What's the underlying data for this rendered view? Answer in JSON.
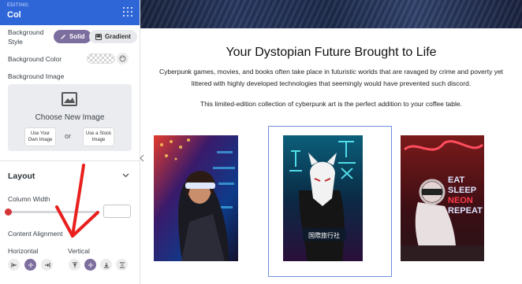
{
  "sidebar": {
    "editing_label": "EDITING:",
    "title": "Col",
    "background_style": {
      "label": "Background Style",
      "options": [
        "Solid",
        "Gradient"
      ],
      "selected": "Solid"
    },
    "background_color": {
      "label": "Background Color"
    },
    "background_image": {
      "label": "Background Image",
      "choose": "Choose New Image",
      "own_image": "Use Your Own Image",
      "or": "or",
      "stock_image": "Use a Stock Image"
    },
    "layout": {
      "heading": "Layout",
      "column_width_label": "Column Width",
      "column_width_value": "",
      "content_alignment_label": "Content Alignment",
      "horizontal_label": "Horizontal",
      "vertical_label": "Vertical",
      "horizontal_selected": "center",
      "vertical_selected": "center"
    },
    "colors": {
      "accent": "#2f66d7",
      "selected": "#7c6e9e",
      "slider": "#d63638",
      "annotation": "#e8201e"
    }
  },
  "content": {
    "headline": "Your Dystopian Future Brought to Life",
    "paragraph_1": "Cyberpunk games, movies, and books often take place in futuristic worlds that are ravaged by crime and poverty yet littered with highly developed technologies that seemingly would have prevented such discord.",
    "paragraph_2": "This limited-edition collection of cyberpunk art is the perfect addition to your coffee table.",
    "gallery": [
      {
        "scene": "woman with neon visor"
      },
      {
        "scene": "masked figure with neon signs",
        "sign_text": "国際旅行社"
      },
      {
        "scene": "seated woman with neon sign",
        "sign_lines": [
          "EAT",
          "SLEEP",
          "NEON",
          "REPEAT"
        ]
      }
    ]
  }
}
